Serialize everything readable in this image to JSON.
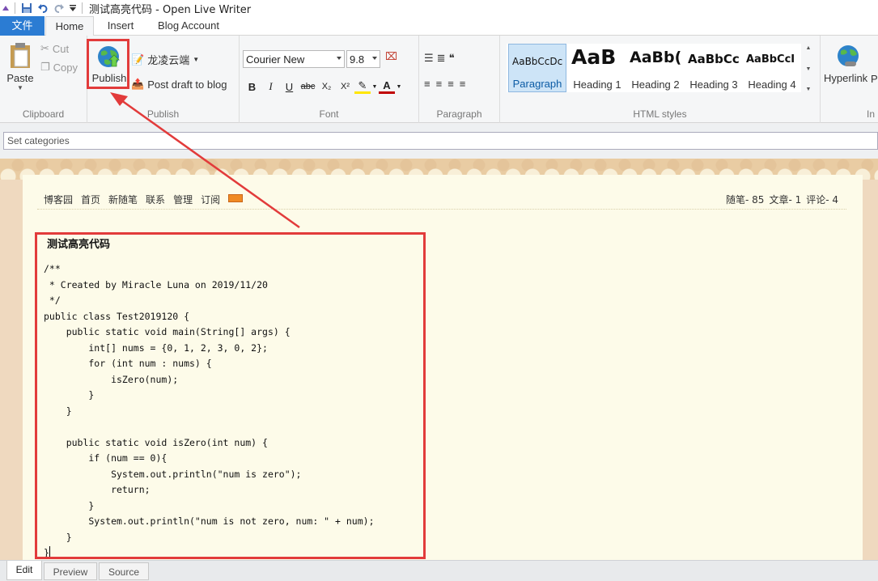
{
  "window": {
    "title": "测试高亮代码 - Open Live Writer"
  },
  "tabs": {
    "file": "文件",
    "home": "Home",
    "insert": "Insert",
    "blog_account": "Blog Account"
  },
  "clipboard": {
    "paste": "Paste",
    "cut": "Cut",
    "copy": "Copy",
    "label": "Clipboard"
  },
  "publish": {
    "publish": "Publish",
    "blog_name": "龙凌云端",
    "post_draft": "Post draft to blog",
    "label": "Publish"
  },
  "font": {
    "family": "Courier New",
    "size": "9.8",
    "label": "Font"
  },
  "paragraph": {
    "label": "Paragraph"
  },
  "html_styles": {
    "label": "HTML styles",
    "items": [
      {
        "sample": "AaBbCcDc",
        "name": "Paragraph"
      },
      {
        "sample": "AaB",
        "name": "Heading 1"
      },
      {
        "sample": "AaBb(",
        "name": "Heading 2"
      },
      {
        "sample": "AaBbCc",
        "name": "Heading 3"
      },
      {
        "sample": "AaBbCcI",
        "name": "Heading 4"
      }
    ]
  },
  "insert": {
    "hyperlink": "Hyperlink",
    "overflow": "P",
    "label": "In"
  },
  "categories": {
    "placeholder": "Set categories"
  },
  "blog_nav": {
    "items": [
      "博客园",
      "首页",
      "新随笔",
      "联系",
      "管理",
      "订阅"
    ],
    "stats": [
      "随笔- 85",
      "文章- 1",
      "评论- 4"
    ]
  },
  "post": {
    "title": "测试高亮代码",
    "code": "/**\n * Created by Miracle Luna on 2019/11/20\n */\npublic class Test2019120 {\n    public static void main(String[] args) {\n        int[] nums = {0, 1, 2, 3, 0, 2};\n        for (int num : nums) {\n            isZero(num);\n        }\n    }\n\n    public static void isZero(int num) {\n        if (num == 0){\n            System.out.println(\"num is zero\");\n            return;\n        }\n        System.out.println(\"num is not zero, num: \" + num);\n    }\n}"
  },
  "bottom_tabs": [
    "Edit",
    "Preview",
    "Source"
  ],
  "colors": {
    "accent": "#2b7cd3",
    "highlight": "#e23b3b",
    "page_bg": "#fdfbe9",
    "editor_bg": "#efd9bf"
  }
}
